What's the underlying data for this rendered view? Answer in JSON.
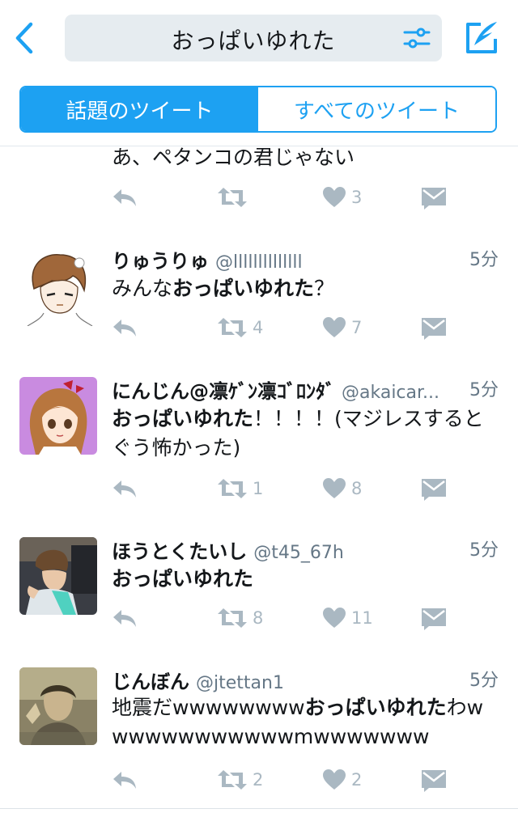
{
  "search": {
    "query": "おっぱいゆれた"
  },
  "tabs": [
    {
      "label": "話題のツイート",
      "active": true
    },
    {
      "label": "すべてのツイート",
      "active": false
    }
  ],
  "colors": {
    "accent": "#1da1f2",
    "action_gray": "#aab8c2",
    "secondary_text": "#657786"
  },
  "tweets": [
    {
      "name": "",
      "handle": "",
      "time": "",
      "text_parts": [
        {
          "t": "あ、ペタンコの君じゃない",
          "b": false
        }
      ],
      "retweets": "",
      "likes": "3"
    },
    {
      "name": "りゅうりゅ",
      "handle": "@llllllllllllll",
      "time": "5分",
      "text_parts": [
        {
          "t": "みんな",
          "b": false
        },
        {
          "t": "おっぱいゆれた",
          "b": true
        },
        {
          "t": "？",
          "b": false
        }
      ],
      "retweets": "4",
      "likes": "7"
    },
    {
      "name": "にんじん@凛ｹﾞﾝ凛ｺﾞﾛﾝﾀﾞ",
      "handle": "@akaicar...",
      "time": "5分",
      "text_parts": [
        {
          "t": "おっぱいゆれた",
          "b": true
        },
        {
          "t": "！！！！(マジレスするとぐう怖かった)",
          "b": false
        }
      ],
      "retweets": "1",
      "likes": "8"
    },
    {
      "name": "ほうとくたいし",
      "handle": "@t45_67h",
      "time": "5分",
      "text_parts": [
        {
          "t": "おっぱいゆれた",
          "b": true
        }
      ],
      "retweets": "8",
      "likes": "11"
    },
    {
      "name": "じんぼん",
      "handle": "@jtettan1",
      "time": "5分",
      "text_parts": [
        {
          "t": "地震だwwwwwwww",
          "b": false
        },
        {
          "t": "おっぱいゆれた",
          "b": true
        },
        {
          "t": "わwwwwwwwwwwwwmwwwwwww",
          "b": false
        }
      ],
      "retweets": "2",
      "likes": "2"
    }
  ]
}
